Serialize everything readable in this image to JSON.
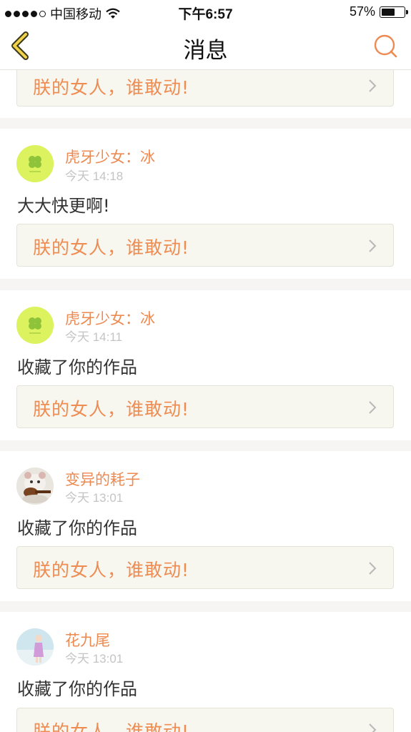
{
  "status_bar": {
    "carrier": "中国移动",
    "time": "下午6:57",
    "battery": "57%",
    "signal_icon": "signal-dots-icon",
    "wifi_icon": "wifi-icon",
    "battery_icon": "battery-icon"
  },
  "nav": {
    "title": "消息",
    "back_icon": "back-chevron-icon",
    "search_icon": "search-icon"
  },
  "colors": {
    "accent": "#ec8a52",
    "muted": "#c4c4c4",
    "ref_bg": "#f7f6ef",
    "divider": "#f7f5f3"
  },
  "items": [
    {
      "ref_title": "朕的女人，谁敢动!"
    },
    {
      "user": "虎牙少女：冰",
      "time": "今天 14:18",
      "message": "大大快更啊!",
      "ref_title": "朕的女人，谁敢动!",
      "avatar": "clover-avatar"
    },
    {
      "user": "虎牙少女：冰",
      "time": "今天 14:11",
      "message": "收藏了你的作品",
      "ref_title": "朕的女人，谁敢动!",
      "avatar": "clover-avatar"
    },
    {
      "user": "变异的耗子",
      "time": "今天 13:01",
      "message": "收藏了你的作品",
      "ref_title": "朕的女人，谁敢动!",
      "avatar": "hamster-guitar-avatar"
    },
    {
      "user": "花九尾",
      "time": "今天 13:01",
      "message": "收藏了你的作品",
      "ref_title": "朕的女人，谁敢动!",
      "avatar": "girl-photo-avatar"
    }
  ]
}
